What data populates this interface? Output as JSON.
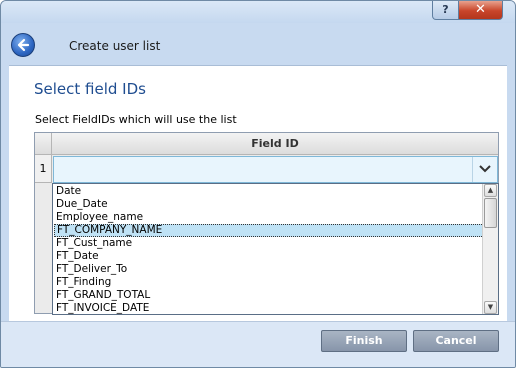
{
  "window": {
    "help_label": "?",
    "close_label": "✕"
  },
  "header": {
    "title": "Create user list"
  },
  "section": {
    "title": "Select field IDs",
    "instruction": "Select FieldIDs which will use the list"
  },
  "grid": {
    "column_header": "Field ID",
    "rows": [
      {
        "number": "1",
        "value": ""
      }
    ]
  },
  "dropdown": {
    "options": [
      "Date",
      "Due_Date",
      "Employee_name",
      "FT_COMPANY_NAME",
      "FT_Cust_name",
      "FT_Date",
      "FT_Deliver_To",
      "FT_Finding",
      "FT_GRAND_TOTAL",
      "FT_INVOICE_DATE"
    ],
    "highlighted_option": "FT_COMPANY_NAME"
  },
  "footer": {
    "finish_label": "Finish",
    "cancel_label": "Cancel"
  },
  "colors": {
    "accent": "#1f4d90",
    "highlight": "#bfe2f5",
    "button": "#8795aa"
  }
}
